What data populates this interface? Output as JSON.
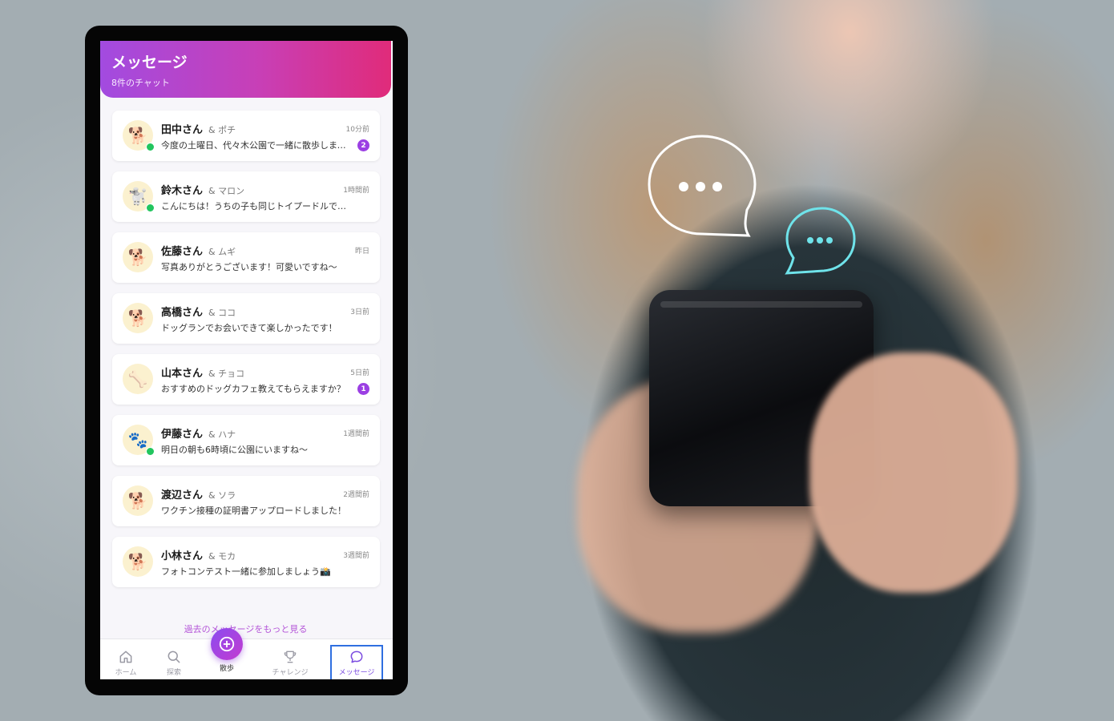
{
  "header": {
    "title": "メッセージ",
    "subtitle": "8件のチャット"
  },
  "chats": [
    {
      "name": "田中さん",
      "dog": "& ポチ",
      "time": "10分前",
      "message": "今度の土曜日、代々木公園で一緒に散歩しませんか？",
      "unread": "2",
      "online": true,
      "avatar": "🐕"
    },
    {
      "name": "鈴木さん",
      "dog": "& マロン",
      "time": "1時間前",
      "message": "こんにちは！うちの子も同じトイプードルです🐩",
      "unread": "",
      "online": true,
      "avatar": "🐩"
    },
    {
      "name": "佐藤さん",
      "dog": "& ムギ",
      "time": "昨日",
      "message": "写真ありがとうございます！可愛いですね〜",
      "unread": "",
      "online": false,
      "avatar": "🐕"
    },
    {
      "name": "高橋さん",
      "dog": "& ココ",
      "time": "3日前",
      "message": "ドッグランでお会いできて楽しかったです！",
      "unread": "",
      "online": false,
      "avatar": "🐕"
    },
    {
      "name": "山本さん",
      "dog": "& チョコ",
      "time": "5日前",
      "message": "おすすめのドッグカフェ教えてもらえますか？",
      "unread": "1",
      "online": false,
      "avatar": "🦴"
    },
    {
      "name": "伊藤さん",
      "dog": "& ハナ",
      "time": "1週間前",
      "message": "明日の朝も6時頃に公園にいますね〜",
      "unread": "",
      "online": true,
      "avatar": "🐾"
    },
    {
      "name": "渡辺さん",
      "dog": "& ソラ",
      "time": "2週間前",
      "message": "ワクチン接種の証明書アップロードしました！",
      "unread": "",
      "online": false,
      "avatar": "🐕"
    },
    {
      "name": "小林さん",
      "dog": "& モカ",
      "time": "3週間前",
      "message": "フォトコンテスト一緒に参加しましょう📸",
      "unread": "",
      "online": false,
      "avatar": "🐕"
    }
  ],
  "more_link": "過去のメッセージをもっと見る",
  "nav": {
    "home": "ホーム",
    "explore": "探索",
    "walk": "散歩",
    "challenge": "チャレンジ",
    "messages": "メッセージ"
  },
  "colors": {
    "accent": "#9b3fe3",
    "header_start": "#a24be0",
    "header_end": "#e02b7a",
    "online": "#22c55e"
  }
}
